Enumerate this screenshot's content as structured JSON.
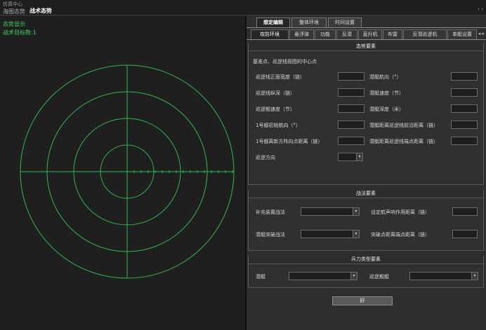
{
  "window": {
    "app_title": "仿真中心",
    "menu_situation": "海图态势",
    "menu_combat": "战术态势",
    "controls": "‹ ›"
  },
  "radar": {
    "title": "态势显示",
    "count": "战术目标数:1"
  },
  "top_tabs": [
    "想定编辑",
    "整体环境",
    "时间设置"
  ],
  "sub_tabs": [
    "攻防环境",
    "悬浮弹",
    "功能",
    "反潜",
    "直升机",
    "布雷",
    "反潜巡逻机",
    "单艇设置"
  ],
  "sub_scroll": "◂ ▸",
  "situation": {
    "title": "态势要素",
    "hint": "基准点、巡逻线视图的中心点",
    "left_labels": [
      "巡逻线正面宽度（链）",
      "巡逻线纵深（链）",
      "巡逻舰速度（节）",
      "1号舰初始航向（°）",
      "1号舰离新方阵向点距离（链）",
      "巡逻方向"
    ],
    "right_labels": [
      "潜艇航向（°）",
      "潜艇速度（节）",
      "潜艇深度（米）",
      "潜艇距离巡逻线前沿距离（链）",
      "潜艇距离巡逻线端点距离（链）"
    ]
  },
  "tactics": {
    "title": "战法要素",
    "left_labels": [
      "补充装置战法",
      "潜艇突破战法"
    ],
    "right_labels": [
      "设定航声响作用距离（链）",
      "突破点距离端点距离（链）"
    ]
  },
  "forces": {
    "title": "兵力类型要素",
    "left_label": "潜艇",
    "right_label": "巡逻舰艇"
  },
  "ok_label": "好",
  "colors": {
    "radar_green": "#2fb84a",
    "panel_bg": "#2e2e2e"
  }
}
